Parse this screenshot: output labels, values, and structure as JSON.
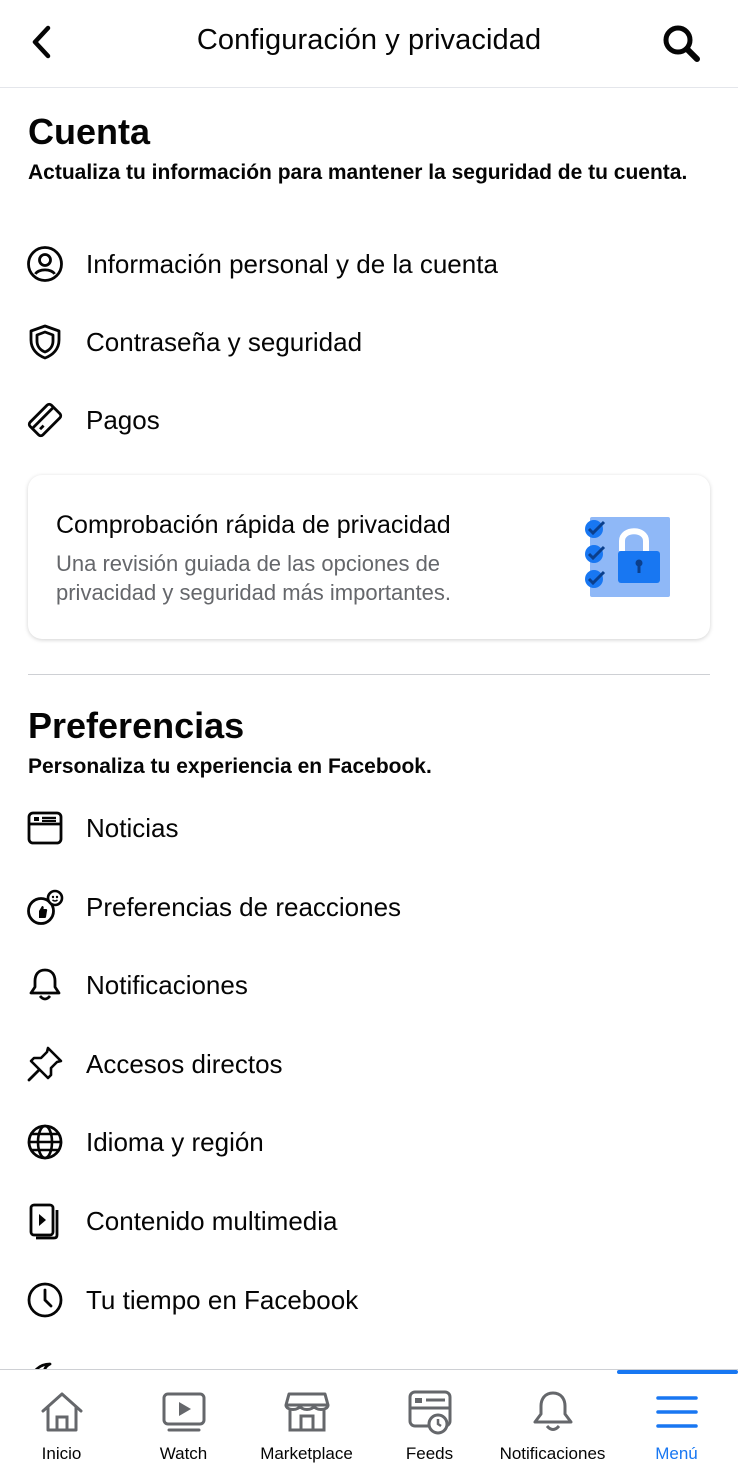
{
  "header": {
    "title": "Configuración y privacidad",
    "back_icon": "chevron-left-icon",
    "search_icon": "search-icon"
  },
  "account": {
    "title": "Cuenta",
    "subtitle": "Actualiza tu información para mantener la seguridad de tu cuenta.",
    "items": [
      {
        "icon": "person-circle-icon",
        "label": "Información personal y de la cuenta"
      },
      {
        "icon": "shield-icon",
        "label": "Contraseña y seguridad"
      },
      {
        "icon": "payment-card-icon",
        "label": "Pagos"
      }
    ],
    "privacy_card": {
      "title": "Comprobación rápida de privacidad",
      "description": "Una revisión guiada de las opciones de privacidad y seguridad más importantes.",
      "illustration": "privacy-lock-illustration"
    }
  },
  "preferences": {
    "title": "Preferencias",
    "subtitle": "Personaliza tu experiencia en Facebook.",
    "items": [
      {
        "icon": "news-feed-icon",
        "label": "Noticias"
      },
      {
        "icon": "reactions-icon",
        "label": "Preferencias de reacciones"
      },
      {
        "icon": "bell-icon",
        "label": "Notificaciones"
      },
      {
        "icon": "pin-icon",
        "label": "Accesos directos"
      },
      {
        "icon": "globe-icon",
        "label": "Idioma y región"
      },
      {
        "icon": "media-icon",
        "label": "Contenido multimedia"
      },
      {
        "icon": "clock-icon",
        "label": "Tu tiempo en Facebook"
      }
    ]
  },
  "tabbar": {
    "tabs": [
      {
        "label": "Inicio",
        "icon": "home-icon",
        "active": false
      },
      {
        "label": "Watch",
        "icon": "watch-icon",
        "active": false
      },
      {
        "label": "Marketplace",
        "icon": "marketplace-icon",
        "active": false
      },
      {
        "label": "Feeds",
        "icon": "feeds-icon",
        "active": false
      },
      {
        "label": "Notificaciones",
        "icon": "bell-icon",
        "active": false
      },
      {
        "label": "Menú",
        "icon": "menu-icon",
        "active": true
      }
    ]
  },
  "colors": {
    "accent": "#1877f2",
    "text": "#050505",
    "secondary_text": "#65676b",
    "divider": "#ced0d4"
  }
}
